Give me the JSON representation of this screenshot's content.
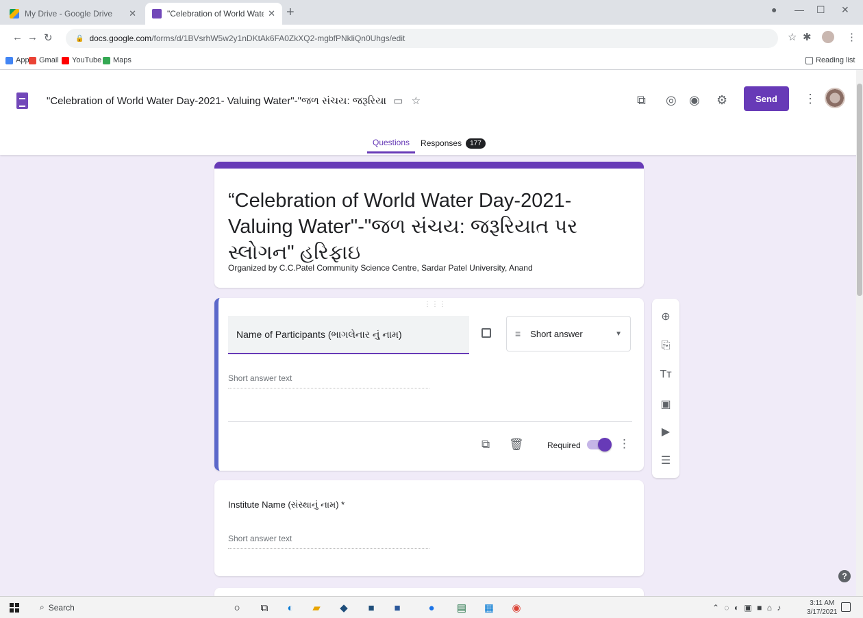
{
  "browser": {
    "tabs": [
      {
        "title": "My Drive - Google Drive",
        "active": false
      },
      {
        "title": "\"Celebration of World Water Da",
        "active": true
      }
    ],
    "url_host": "docs.google.com",
    "url_path": "/forms/d/1BVsrhW5w2y1nDKtAk6FA0ZkXQ2-mgbfPNkliQn0Uhgs/edit",
    "bookmarks": [
      "Apps",
      "Gmail",
      "YouTube",
      "Maps"
    ],
    "reading_list": "Reading list"
  },
  "form_header": {
    "doc_title": "\"Celebration of World Water Day-2021- Valuing Water\"-\"જળ સંચય: જરૂરિયા",
    "send_label": "Send",
    "tabs": {
      "questions": "Questions",
      "responses": "Responses",
      "responses_count": "177"
    }
  },
  "title_card": {
    "title": "“Celebration of World Water Day-2021- Valuing Water\"-\"જળ સંચય: જરૂરિયાત પર સ્લોગન\" હરિફાઇ",
    "description": "Organized by C.C.Patel Community Science Centre, Sardar Patel University, Anand"
  },
  "question_1": {
    "title": "Name of Participants (ભાગલેનાર નું નામ)",
    "type": "Short answer",
    "answer_placeholder": "Short answer text",
    "required_label": "Required",
    "required": true
  },
  "question_2": {
    "title": "Institute Name (સંસ્થાનું નામ) *",
    "answer_placeholder": "Short answer text"
  },
  "taskbar": {
    "search": "Search",
    "time": "3:11 AM",
    "date": "3/17/2021"
  },
  "colors": {
    "accent": "#673ab7",
    "background": "#f0ebf8",
    "active_border": "#5b67ca"
  }
}
